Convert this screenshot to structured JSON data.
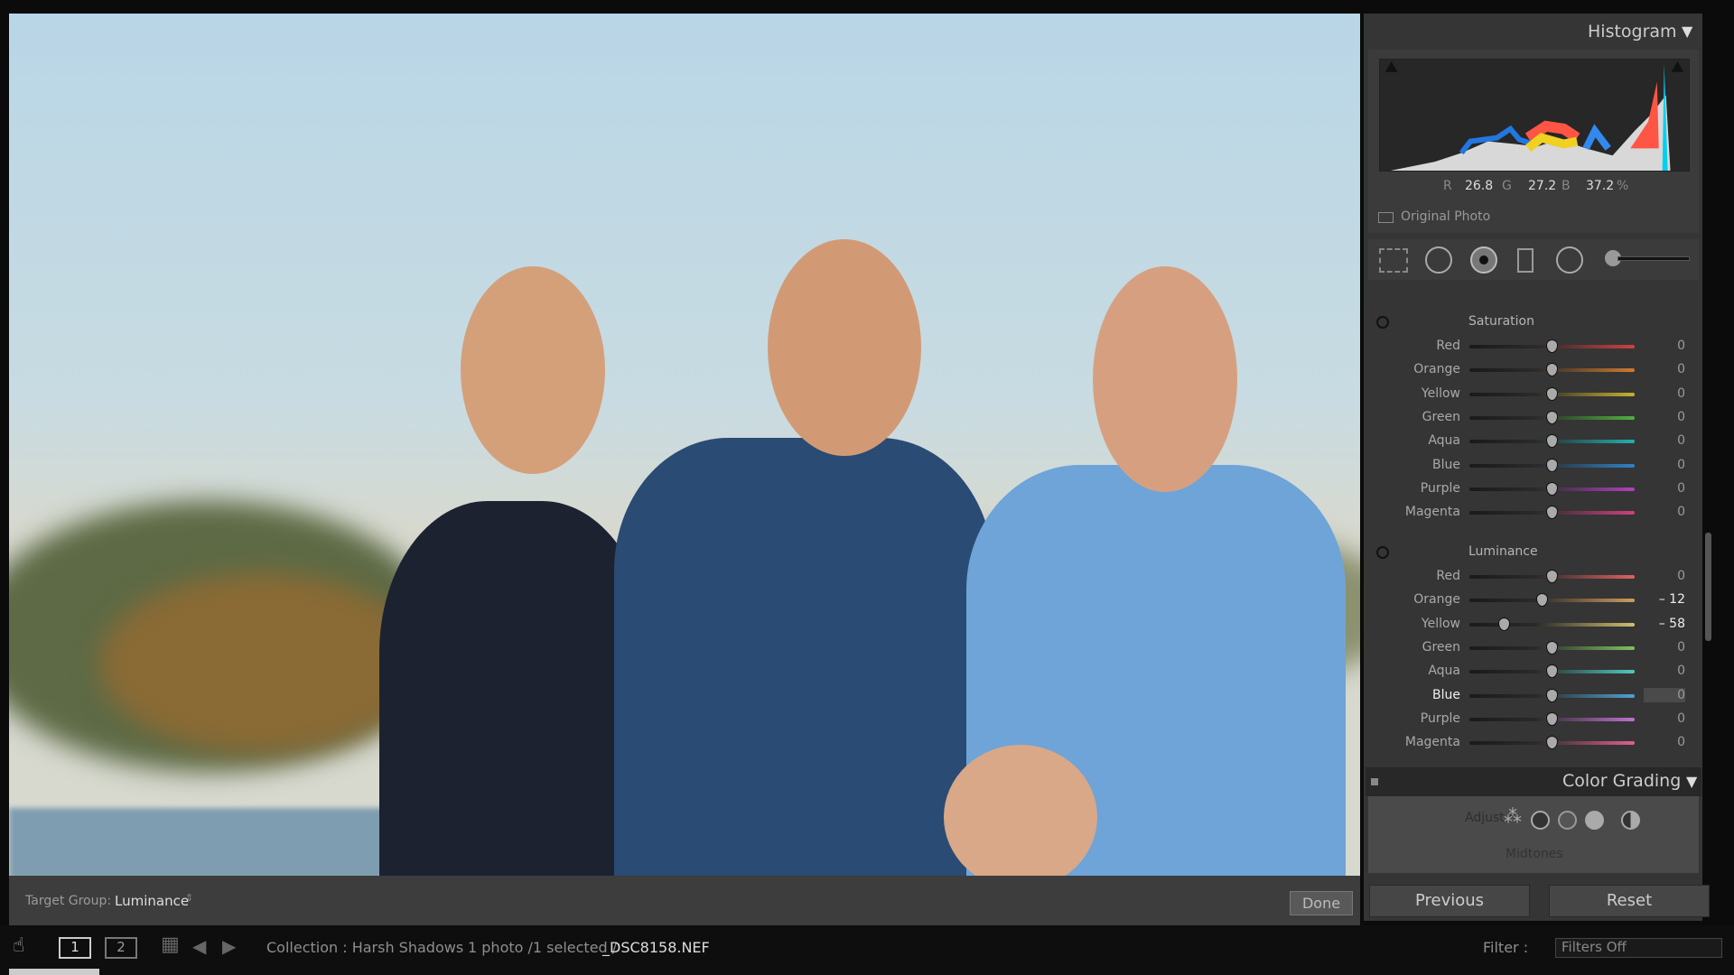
{
  "photo": {
    "subject": "family portrait"
  },
  "target_group": {
    "label": "Target Group:",
    "value": "Luminance"
  },
  "done_label": "Done",
  "histogram": {
    "title": "Histogram",
    "r_label": "R",
    "r": "26.8",
    "g_label": "G",
    "g": "27.2",
    "b_label": "B",
    "b": "37.2",
    "pct": "%",
    "original_photo": "Original Photo"
  },
  "saturation": {
    "title": "Saturation",
    "rows": [
      {
        "label": "Red",
        "value": 0,
        "display": "0",
        "color": "#d04040"
      },
      {
        "label": "Orange",
        "value": 0,
        "display": "0",
        "color": "#d07a30"
      },
      {
        "label": "Yellow",
        "value": 0,
        "display": "0",
        "color": "#c8b030"
      },
      {
        "label": "Green",
        "value": 0,
        "display": "0",
        "color": "#50b040"
      },
      {
        "label": "Aqua",
        "value": 0,
        "display": "0",
        "color": "#20b0b0"
      },
      {
        "label": "Blue",
        "value": 0,
        "display": "0",
        "color": "#3080c8"
      },
      {
        "label": "Purple",
        "value": 0,
        "display": "0",
        "color": "#b040c0"
      },
      {
        "label": "Magenta",
        "value": 0,
        "display": "0",
        "color": "#d04080"
      }
    ]
  },
  "luminance": {
    "title": "Luminance",
    "rows": [
      {
        "label": "Red",
        "value": 0,
        "display": "0",
        "color": "#e06060"
      },
      {
        "label": "Orange",
        "value": -12,
        "display": "– 12",
        "color": "#d09a60"
      },
      {
        "label": "Yellow",
        "value": -58,
        "display": "– 58",
        "color": "#d0c070"
      },
      {
        "label": "Green",
        "value": 0,
        "display": "0",
        "color": "#80c060"
      },
      {
        "label": "Aqua",
        "value": 0,
        "display": "0",
        "color": "#50c8c0"
      },
      {
        "label": "Blue",
        "value": 0,
        "display": "0",
        "color": "#50a0d0",
        "active": true
      },
      {
        "label": "Purple",
        "value": 0,
        "display": "0",
        "color": "#c070d0"
      },
      {
        "label": "Magenta",
        "value": 0,
        "display": "0",
        "color": "#e06090"
      }
    ]
  },
  "color_grading": {
    "title": "Color Grading",
    "adjust": "Adjust :",
    "mode": "Midtones"
  },
  "buttons": {
    "previous": "Previous",
    "reset": "Reset"
  },
  "bottom": {
    "view1": "1",
    "view2": "2",
    "collection": "Collection : Harsh Shadows",
    "selection": "1 photo /1 selected /",
    "filename": "_DSC8158.NEF",
    "filter_label": "Filter :",
    "filter_value": "Filters Off"
  }
}
